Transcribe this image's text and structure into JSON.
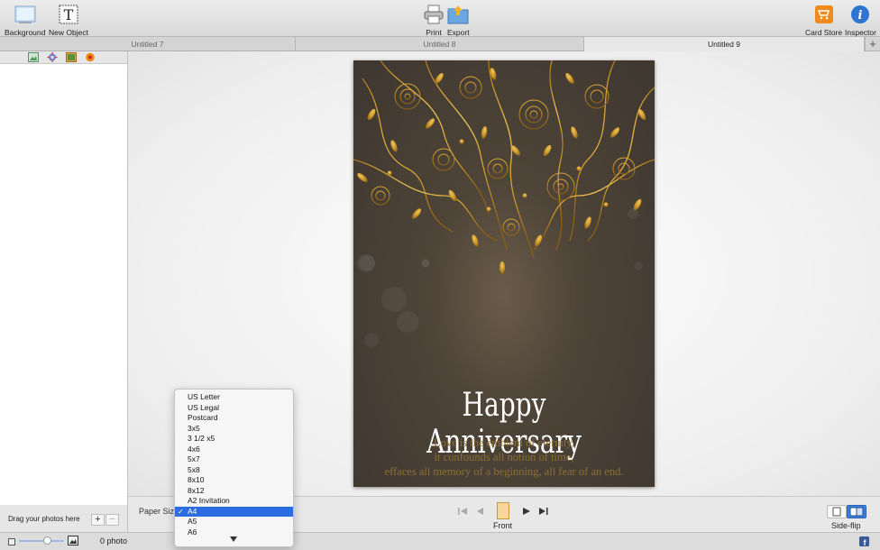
{
  "toolbar": {
    "background_label": "Background",
    "new_object_label": "New Object",
    "print_label": "Print",
    "export_label": "Export",
    "card_store_label": "Card Store",
    "inspector_label": "Inspector"
  },
  "tabs": [
    {
      "label": "Untitled 7"
    },
    {
      "label": "Untitled 8"
    },
    {
      "label": "Untitled 9",
      "active": true
    }
  ],
  "sidebar": {
    "tool_icons": [
      "image-icon",
      "gear-icon",
      "picture-icon",
      "flower-icon"
    ],
    "drag_text": "Drag your photos here",
    "add_label": "+",
    "remove_label": "−"
  },
  "card": {
    "title": "Happy Anniversary",
    "verse": [
      "Love is the emblem of eternity,",
      "it confounds all notion of time,",
      "effaces all memory of a beginning, all fear of an end."
    ],
    "colors": {
      "background": "#4a4036",
      "ornament": "#c9952a",
      "verse": "#8b6f34"
    }
  },
  "bottom": {
    "paper_size_label": "Paper Size",
    "page_label": "Front",
    "side_flip_label": "Side-flip"
  },
  "status": {
    "photo_count": "0 photo"
  },
  "paper_size_menu": {
    "options": [
      "US Letter",
      "US Legal",
      "Postcard",
      "3x5",
      "3 1/2 x5",
      "4x6",
      "5x7",
      "5x8",
      "8x10",
      "8x12",
      "A2 Invitation",
      "A4",
      "A5",
      "A6"
    ],
    "selected": "A4",
    "check_mark": "✓"
  },
  "colors": {
    "selection": "#2b6de0",
    "card_store_orange": "#f08a1c",
    "inspector_blue": "#2f74d0"
  }
}
